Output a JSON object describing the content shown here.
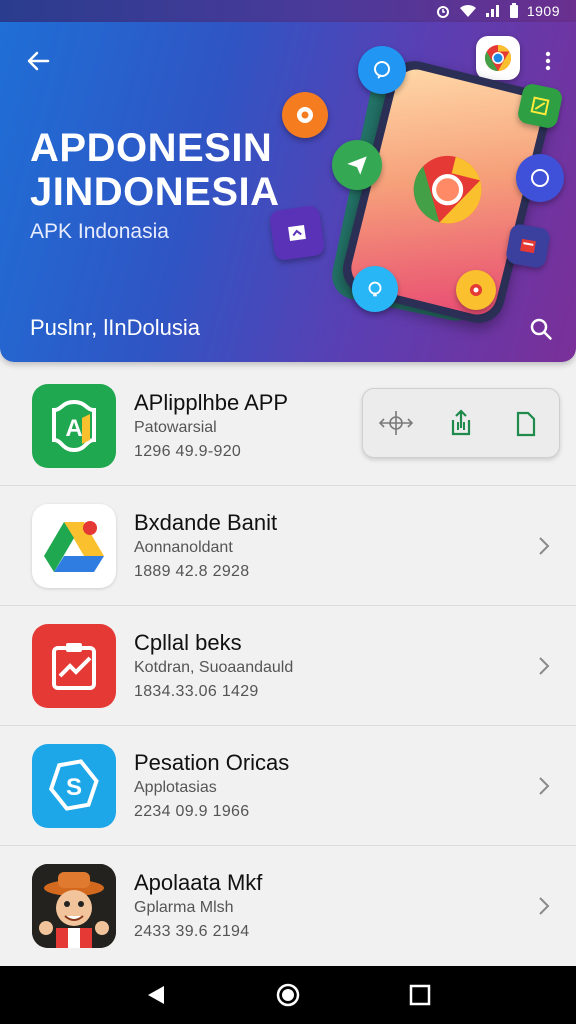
{
  "status_bar": {
    "time": "1909"
  },
  "header": {
    "title_line1": "APDONESIN",
    "title_line2": "JINDONESIA",
    "subtitle": "APK Indonasia",
    "location": "Puslnr, lInDolusia"
  },
  "apps": [
    {
      "name": "APlipplhbe APP",
      "category": "Patowarsial",
      "meta": "1296 49.9-920",
      "icon": "apk-a-icon",
      "color": "#1fa84f"
    },
    {
      "name": "Bxdande Banit",
      "category": "Aonnanoldant",
      "meta": "1889 42.8 2928",
      "icon": "drive-icon",
      "color": "#ffffff"
    },
    {
      "name": "Cpllal beks",
      "category": "Kotdran, Suoaandauld",
      "meta": "1834.33.06 1429",
      "icon": "checklist-icon",
      "color": "#e53935"
    },
    {
      "name": "Pesation Oricas",
      "category": "Applotasias",
      "meta": "2234 09.9 1966",
      "icon": "tag-s-icon",
      "color": "#1da7e8"
    },
    {
      "name": "Apolaata Mkf",
      "category": "Gplarma Mlsh",
      "meta": "2433 39.6 2194",
      "icon": "cartoon-avatar-icon",
      "color": "#2b2b2b"
    }
  ],
  "colors": {
    "header_start": "#1f6fd6",
    "header_end": "#7a2f98",
    "accent_green": "#1f8a4c"
  }
}
